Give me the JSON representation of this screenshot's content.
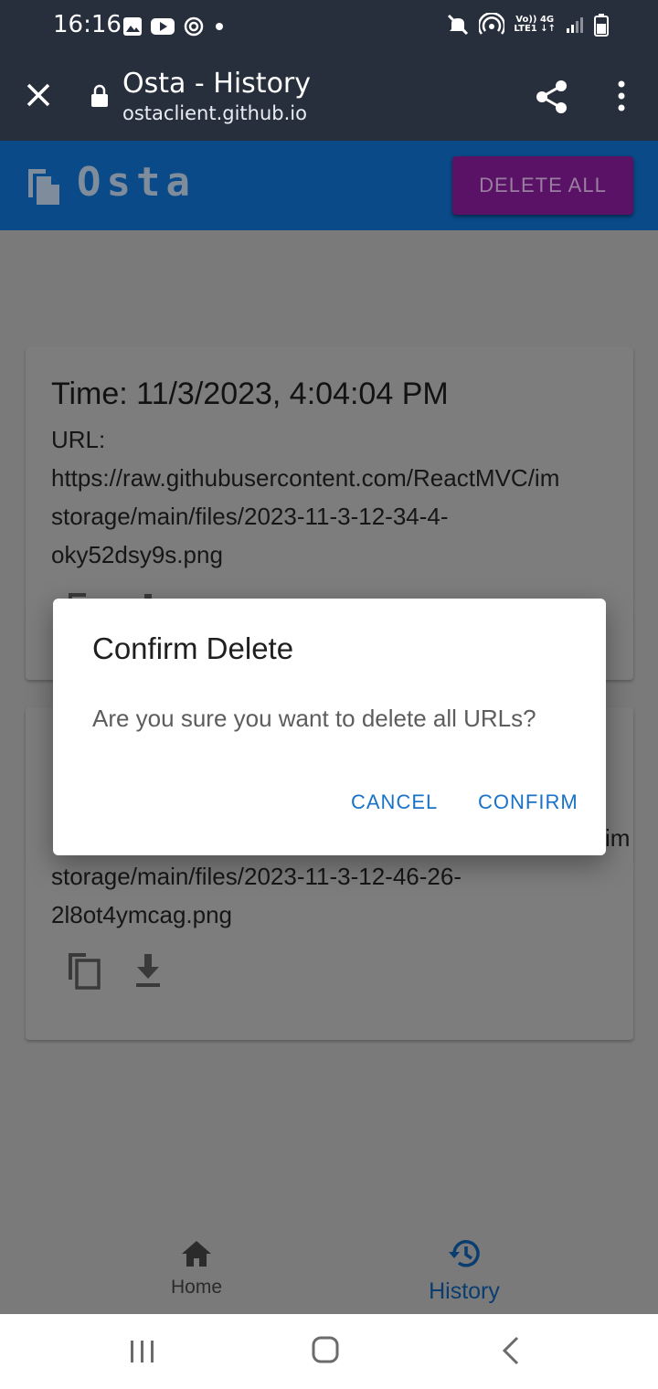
{
  "status_bar": {
    "time": "16:16",
    "network_line1": "Vo)) 4G",
    "network_line2": "LTE1 ↓↑"
  },
  "browser": {
    "page_title": "Osta - History",
    "url": "ostaclient.github.io"
  },
  "app_header": {
    "logo": "Osta",
    "delete_all_label": "DELETE ALL"
  },
  "history": [
    {
      "time": "Time: 11/3/2023, 4:04:04 PM",
      "url_label": "URL:",
      "url_lines": [
        "https://raw.githubusercontent.com/ReactMVC/im",
        "storage/main/files/2023-11-3-12-34-4-",
        "oky52dsy9s.png"
      ]
    },
    {
      "time": "",
      "url_label": "",
      "url_lines": [
        "im",
        "storage/main/files/2023-11-3-12-46-26-",
        "2l8ot4ymcag.png"
      ]
    }
  ],
  "bottom_nav": {
    "home_label": "Home",
    "history_label": "History",
    "active": "History"
  },
  "dialog": {
    "title": "Confirm Delete",
    "message": "Are you sure you want to delete all URLs?",
    "cancel_label": "CANCEL",
    "confirm_label": "CONFIRM"
  },
  "colors": {
    "browser_bar": "#272f3c",
    "app_bar": "#0a4a89",
    "delete_all_button": "#5a1266",
    "overlay_background": "#7a7a7a",
    "dialog_action": "#1972c7"
  }
}
